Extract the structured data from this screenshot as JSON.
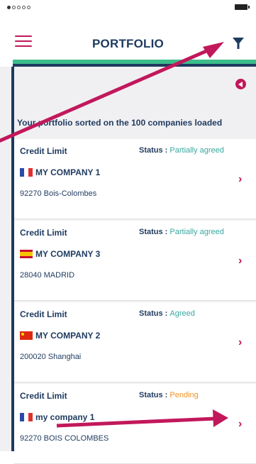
{
  "header": {
    "title": "PORTFOLIO"
  },
  "info_text": "Your portfolio sorted on the 100 companies loaded",
  "cards": [
    {
      "label": "Credit Limit",
      "status_label": "Status : ",
      "status_value": "Partially agreed",
      "status_color": "#3aa8a0",
      "company": "MY COMPANY 1",
      "address": "92270 Bois-Colombes",
      "flag": "fr-flag-icon"
    },
    {
      "label": "Credit Limit",
      "status_label": "Status : ",
      "status_value": "Partially agreed",
      "status_color": "#3aa8a0",
      "company": "MY COMPANY 3",
      "address": "28040 MADRID",
      "flag": "es-flag-icon"
    },
    {
      "label": "Credit Limit",
      "status_label": "Status : ",
      "status_value": "Agreed",
      "status_color": "#3aa8a0",
      "company": "MY COMPANY 2",
      "address": "200020 Shanghai",
      "flag": "cn-flag-icon"
    },
    {
      "label": "Credit Limit",
      "status_label": "Status : ",
      "status_value": "Pending",
      "status_color": "#f39221",
      "company": "my company 1",
      "address": "92270 BOIS COLOMBES",
      "flag": "fr-flag-icon"
    }
  ],
  "colors": {
    "navy": "#1e3a5f",
    "accent": "#c2185b",
    "green": "#3dbd8a"
  }
}
